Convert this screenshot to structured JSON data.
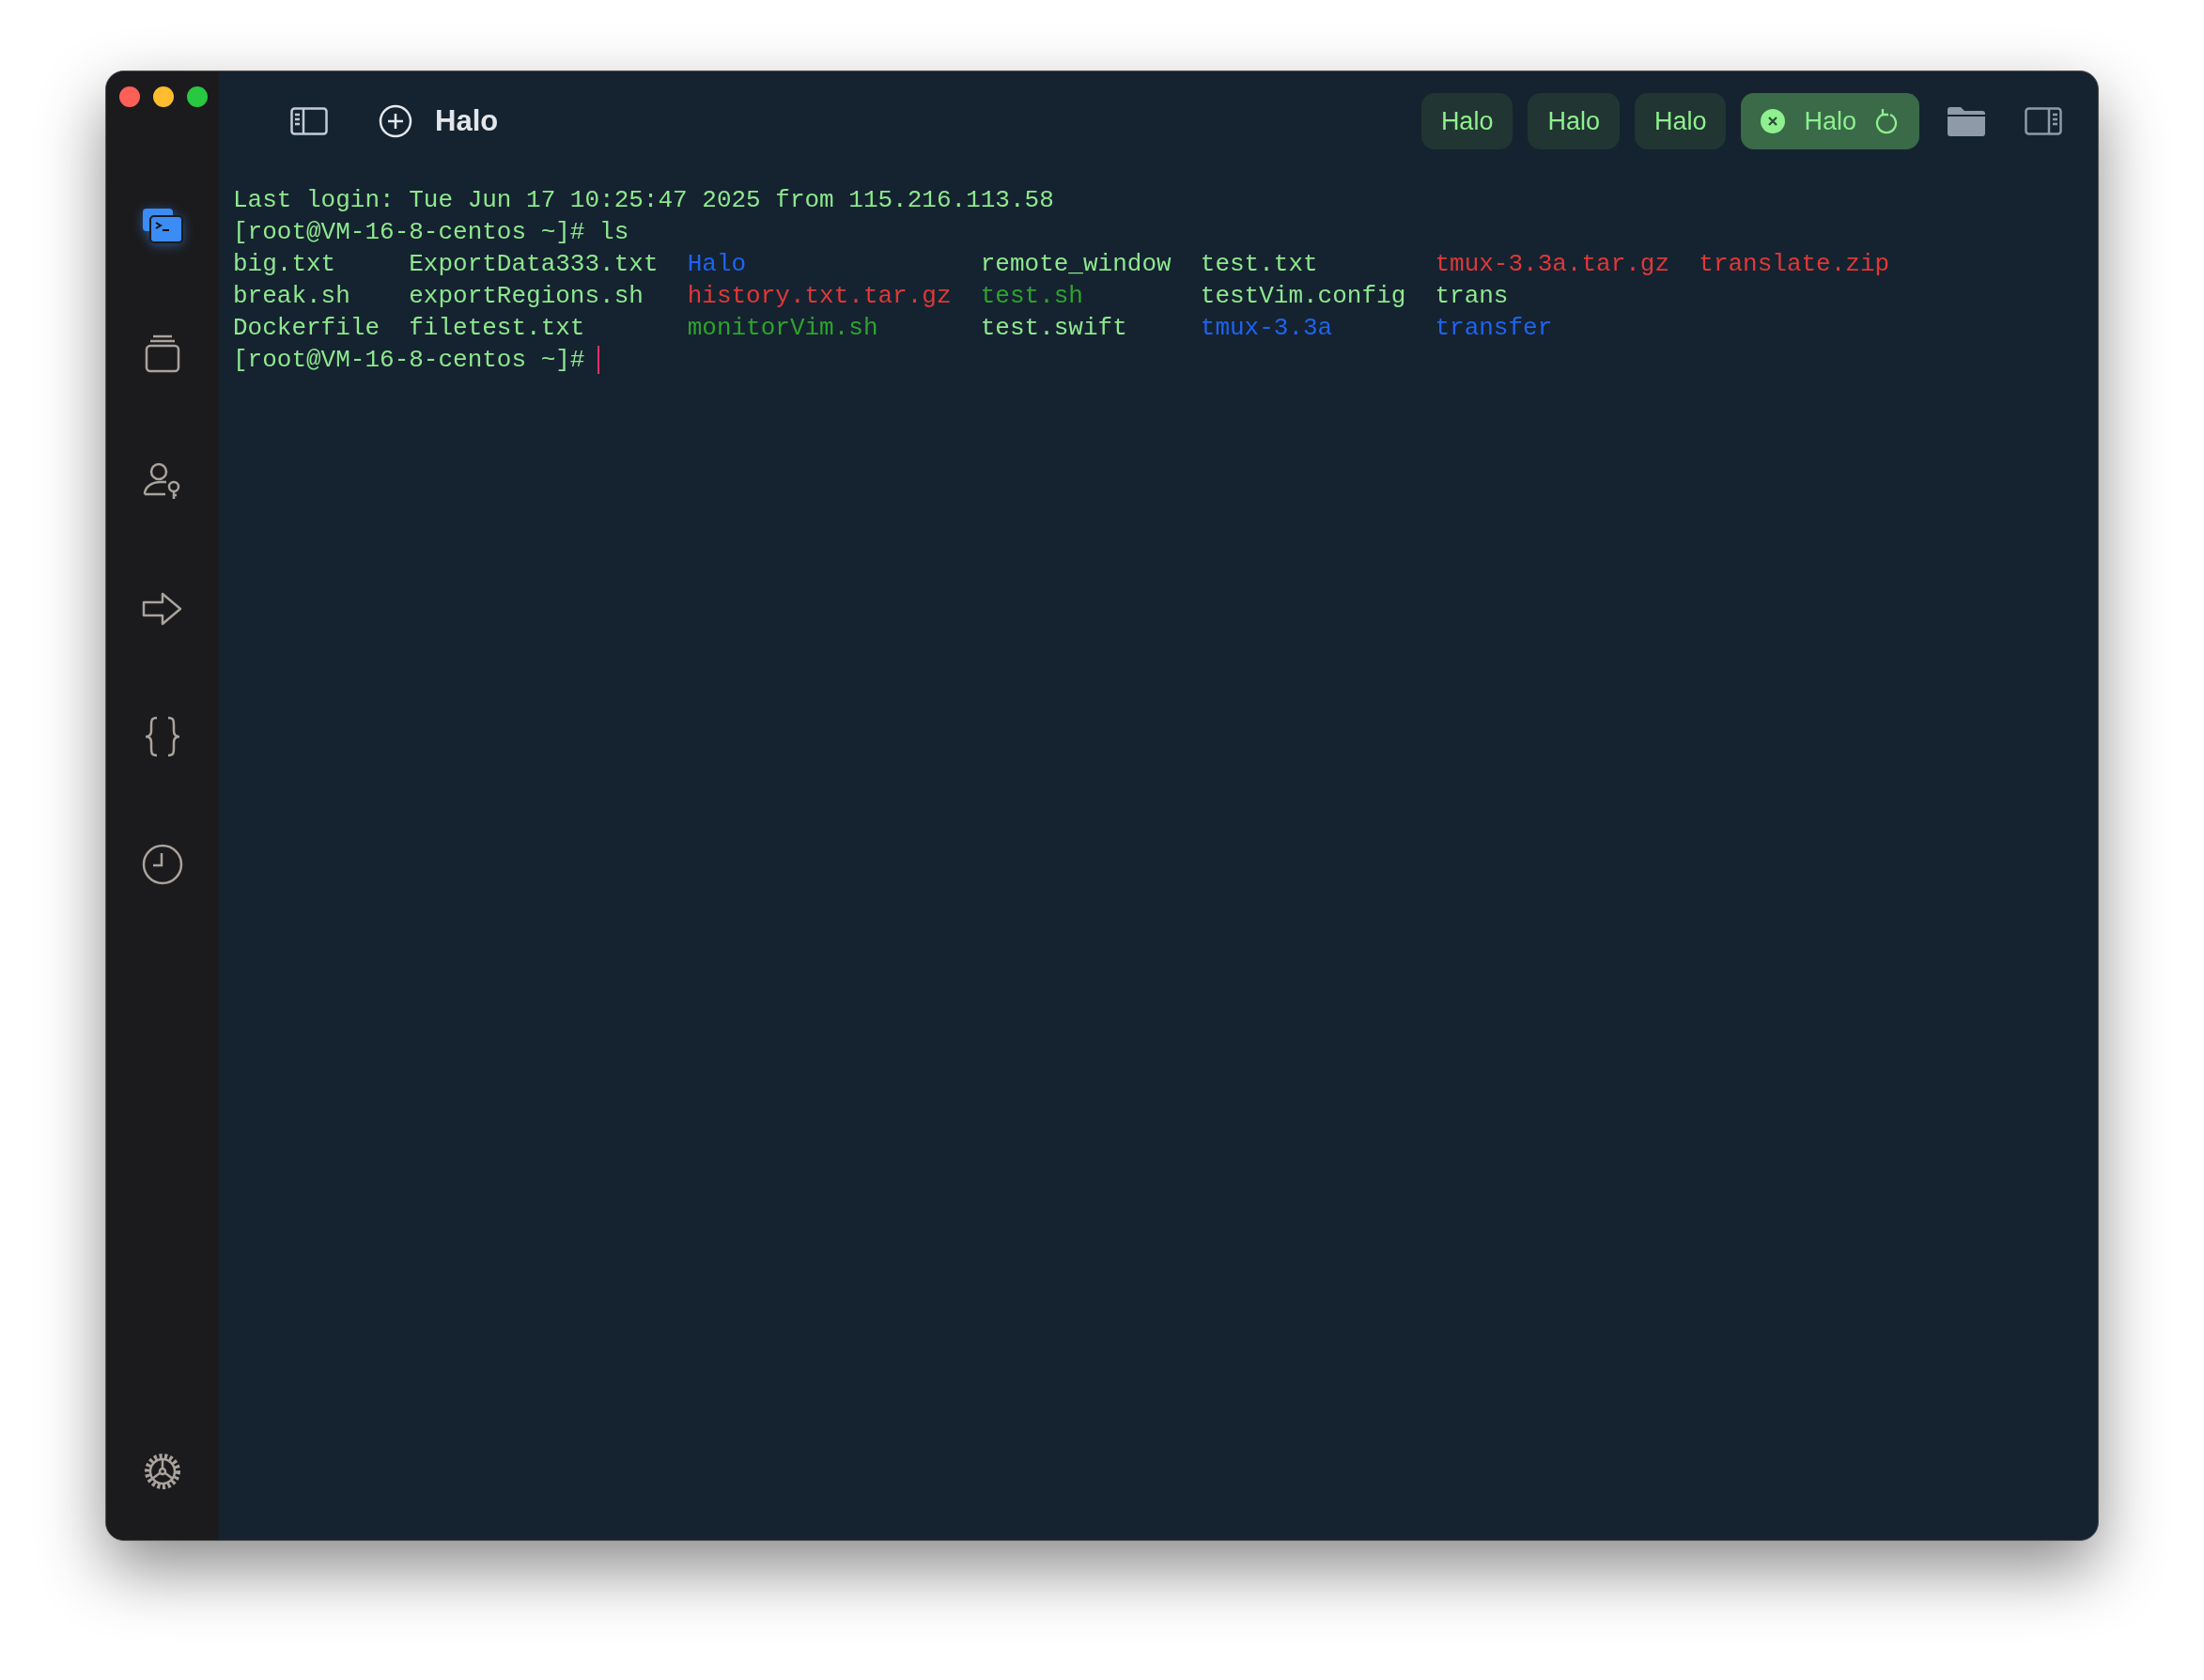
{
  "window": {
    "title": "Halo"
  },
  "sidebar": {
    "items": [
      {
        "kind": "terminal",
        "selected": true
      },
      {
        "kind": "stack",
        "selected": false
      },
      {
        "kind": "user-key",
        "selected": false
      },
      {
        "kind": "arrow",
        "selected": false
      },
      {
        "kind": "braces",
        "selected": false
      },
      {
        "kind": "clock",
        "selected": false
      }
    ]
  },
  "tabs": [
    {
      "label": "Halo",
      "selected": false
    },
    {
      "label": "Halo",
      "selected": false
    },
    {
      "label": "Halo",
      "selected": false
    },
    {
      "label": "Halo",
      "selected": true
    }
  ],
  "terminal": {
    "lines": [
      "Last login: Tue Jun 17 10:25:47 2025 from 115.216.113.58",
      "[root@VM-16-8-centos ~]# ls"
    ],
    "files": [
      {
        "name": "big.txt",
        "kind": "file"
      },
      {
        "name": "break.sh",
        "kind": "file"
      },
      {
        "name": "Dockerfile",
        "kind": "file"
      },
      {
        "name": "ExportData333.txt",
        "kind": "file"
      },
      {
        "name": "exportRegions.sh",
        "kind": "file"
      },
      {
        "name": "filetest.txt",
        "kind": "file"
      },
      {
        "name": "Halo",
        "kind": "directory"
      },
      {
        "name": "history.txt.tar.gz",
        "kind": "archive"
      },
      {
        "name": "monitorVim.sh",
        "kind": "executable"
      },
      {
        "name": "remote_window",
        "kind": "file"
      },
      {
        "name": "test.sh",
        "kind": "executable"
      },
      {
        "name": "test.swift",
        "kind": "file"
      },
      {
        "name": "test.txt",
        "kind": "file"
      },
      {
        "name": "testVim.config",
        "kind": "file"
      },
      {
        "name": "tmux-3.3a",
        "kind": "directory"
      },
      {
        "name": "tmux-3.3a.tar.gz",
        "kind": "archive"
      },
      {
        "name": "trans",
        "kind": "file"
      },
      {
        "name": "transfer",
        "kind": "directory"
      },
      {
        "name": "translate.zip",
        "kind": "archive"
      }
    ],
    "prompt": "[root@VM-16-8-centos ~]#"
  }
}
